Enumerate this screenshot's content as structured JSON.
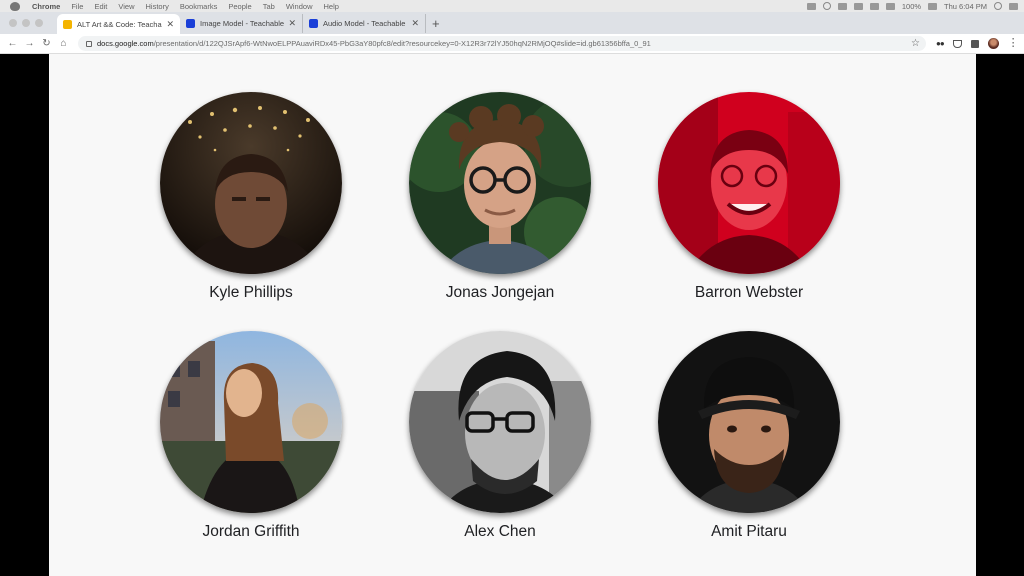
{
  "menubar": {
    "app": "Chrome",
    "items": [
      "File",
      "Edit",
      "View",
      "History",
      "Bookmarks",
      "People",
      "Tab",
      "Window",
      "Help"
    ],
    "battery": "100%",
    "clock": "Thu 6:04 PM"
  },
  "tabs": [
    {
      "label": "ALT Art && Code: Teachable M",
      "favicon": "slides-icon",
      "active": true
    },
    {
      "label": "Image Model - Teachable Mach",
      "favicon": "teachable-machine-icon",
      "active": false
    },
    {
      "label": "Audio Model - Teachable Mach",
      "favicon": "teachable-machine-icon",
      "active": false
    }
  ],
  "address_bar": {
    "host": "docs.google.com",
    "path": "/presentation/d/122QJSrApf6-WtNwoELPPAuaviRDx45-PbG3aY80pfc8/edit?resourcekey=0-X12R3r72lYJ50hqN2RMjOQ#slide=id.gb61356bffa_0_91"
  },
  "people": [
    {
      "name": "Kyle Phillips"
    },
    {
      "name": "Jonas Jongejan"
    },
    {
      "name": "Barron Webster"
    },
    {
      "name": "Jordan Griffith"
    },
    {
      "name": "Alex Chen"
    },
    {
      "name": "Amit Pitaru"
    }
  ]
}
